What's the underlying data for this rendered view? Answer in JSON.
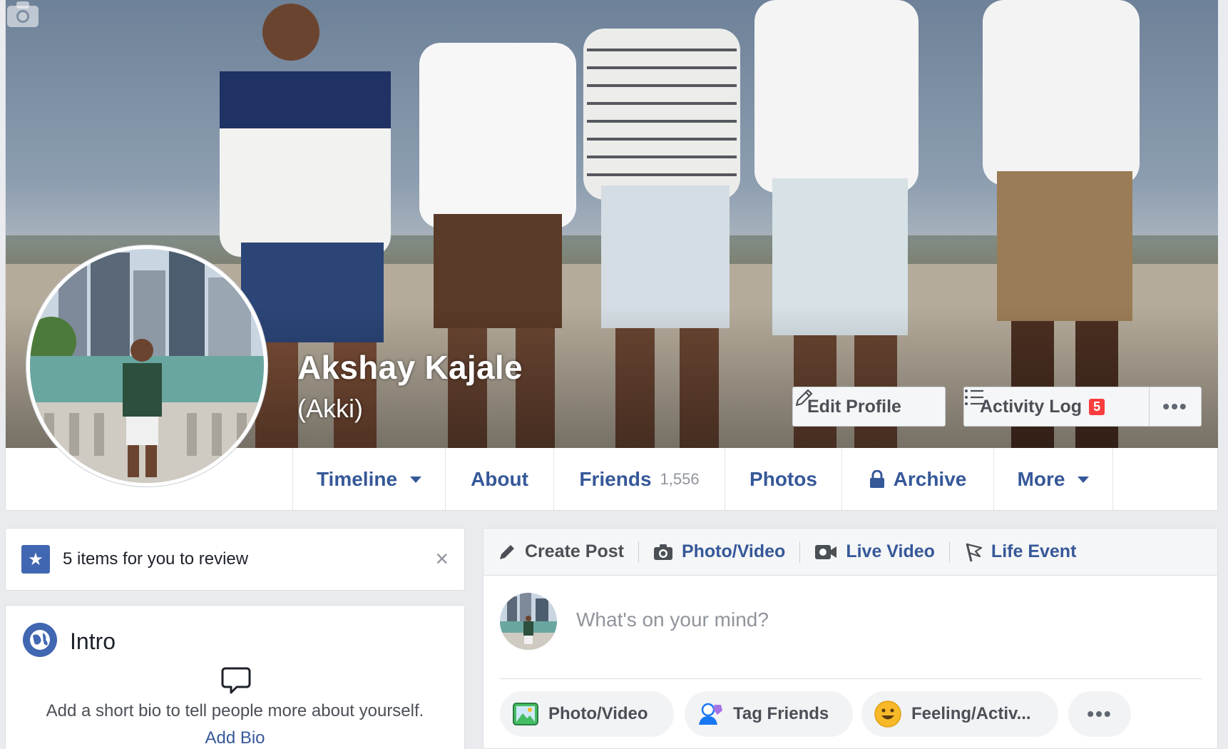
{
  "profile": {
    "name": "Akshay Kajale",
    "alternate_name": "(Akki)"
  },
  "cover_actions": {
    "edit_profile": "Edit Profile",
    "activity_log": "Activity Log",
    "activity_badge": "5",
    "more": "•••"
  },
  "tabs": [
    {
      "label": "Timeline",
      "has_caret": true
    },
    {
      "label": "About"
    },
    {
      "label": "Friends",
      "count": "1,556"
    },
    {
      "label": "Photos"
    },
    {
      "label": "Archive",
      "icon": "lock-icon"
    },
    {
      "label": "More",
      "has_caret": true
    }
  ],
  "review": {
    "text": "5 items for you to review",
    "close": "×"
  },
  "intro": {
    "title": "Intro",
    "bio_prompt": "Add a short bio to tell people more about yourself.",
    "add_bio": "Add Bio"
  },
  "composer": {
    "tabs": [
      "Create Post",
      "Photo/Video",
      "Live Video",
      "Life Event"
    ],
    "placeholder": "What's on your mind?",
    "actions": {
      "photo_video": "Photo/Video",
      "tag_friends": "Tag Friends",
      "feeling": "Feeling/Activ...",
      "more": "•••"
    }
  },
  "colors": {
    "brand_blue": "#4267b2",
    "link_blue": "#365899",
    "badge_red": "#fa3e3e",
    "page_bg": "#e9ebee"
  }
}
